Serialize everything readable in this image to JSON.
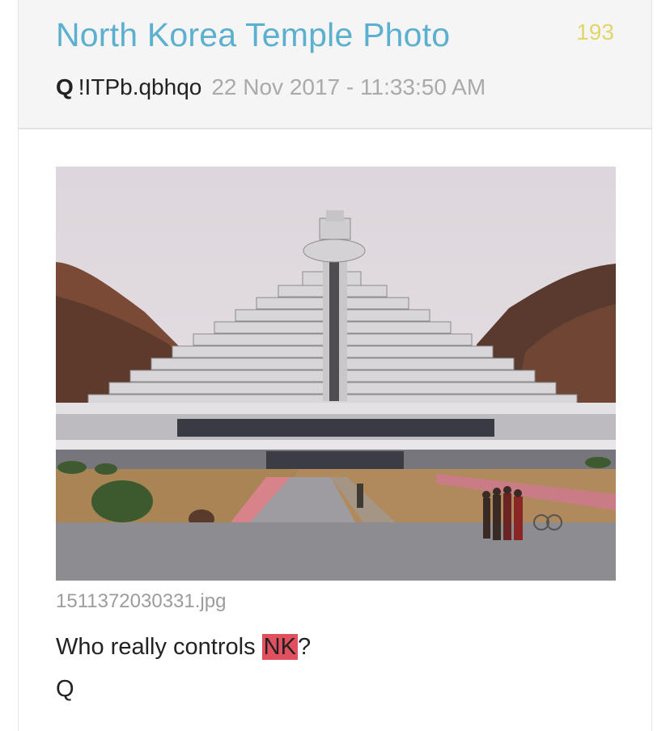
{
  "post": {
    "title": "North Korea Temple Photo",
    "count": "193",
    "author": "Q",
    "tripcode": "!ITPb.qbhqo",
    "timestamp": "22 Nov 2017 - 11:33:50 AM"
  },
  "image": {
    "filename": "1511372030331.jpg"
  },
  "message": {
    "before": "Who really controls ",
    "highlight": "NK",
    "after": "?",
    "signature": "Q"
  },
  "colors": {
    "title": "#5cb0cf",
    "count": "#e2d66a",
    "highlight": "#e0505f"
  }
}
